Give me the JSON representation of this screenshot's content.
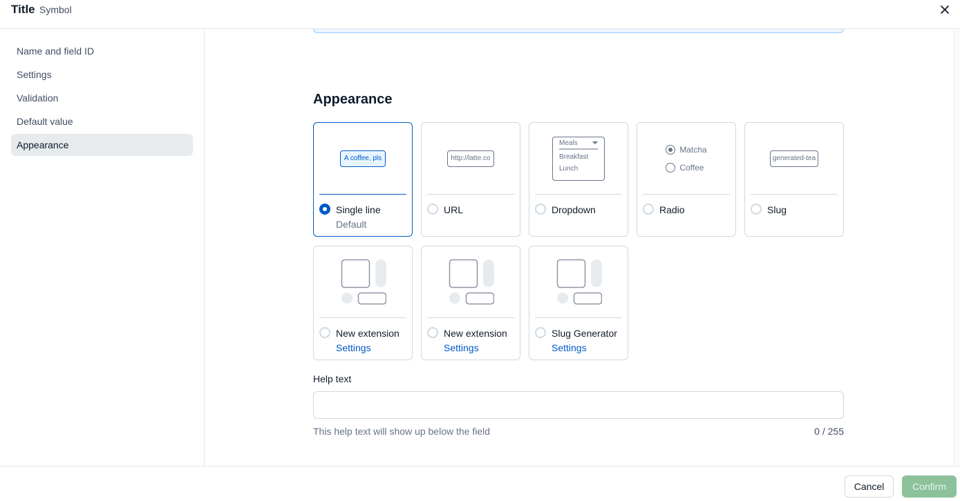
{
  "header": {
    "title": "Title",
    "subtitle": "Symbol",
    "close_icon": "close-icon"
  },
  "sidebar": {
    "items": [
      {
        "label": "Name and field ID",
        "active": false
      },
      {
        "label": "Settings",
        "active": false
      },
      {
        "label": "Validation",
        "active": false
      },
      {
        "label": "Default value",
        "active": false
      },
      {
        "label": "Appearance",
        "active": true
      }
    ]
  },
  "appearance": {
    "title": "Appearance",
    "selected": "Single line",
    "options": [
      {
        "label": "Single line",
        "sub": "Default",
        "preview_text": "A coffee, pls",
        "selected": true
      },
      {
        "label": "URL",
        "preview_text": "http://latte.co",
        "selected": false
      },
      {
        "label": "Dropdown",
        "preview_head": "Meals",
        "preview_options": [
          "Breakfast",
          "Lunch"
        ],
        "selected": false
      },
      {
        "label": "Radio",
        "preview_options": [
          "Matcha",
          "Coffee"
        ],
        "preview_checked": "Matcha",
        "selected": false
      },
      {
        "label": "Slug",
        "preview_text": "generated-tea",
        "selected": false
      },
      {
        "label": "New extension",
        "link": "Settings",
        "selected": false
      },
      {
        "label": "New extension",
        "link": "Settings",
        "selected": false
      },
      {
        "label": "Slug Generator",
        "link": "Settings",
        "selected": false
      }
    ]
  },
  "help_text": {
    "label": "Help text",
    "value": "",
    "placeholder": "",
    "hint": "This help text will show up below the field",
    "count": "0 / 255"
  },
  "footer": {
    "cancel_label": "Cancel",
    "confirm_label": "Confirm"
  },
  "colors": {
    "primary": "#0059c8",
    "confirm_disabled": "#8cc19a",
    "active_nav": "#e7ebee"
  }
}
